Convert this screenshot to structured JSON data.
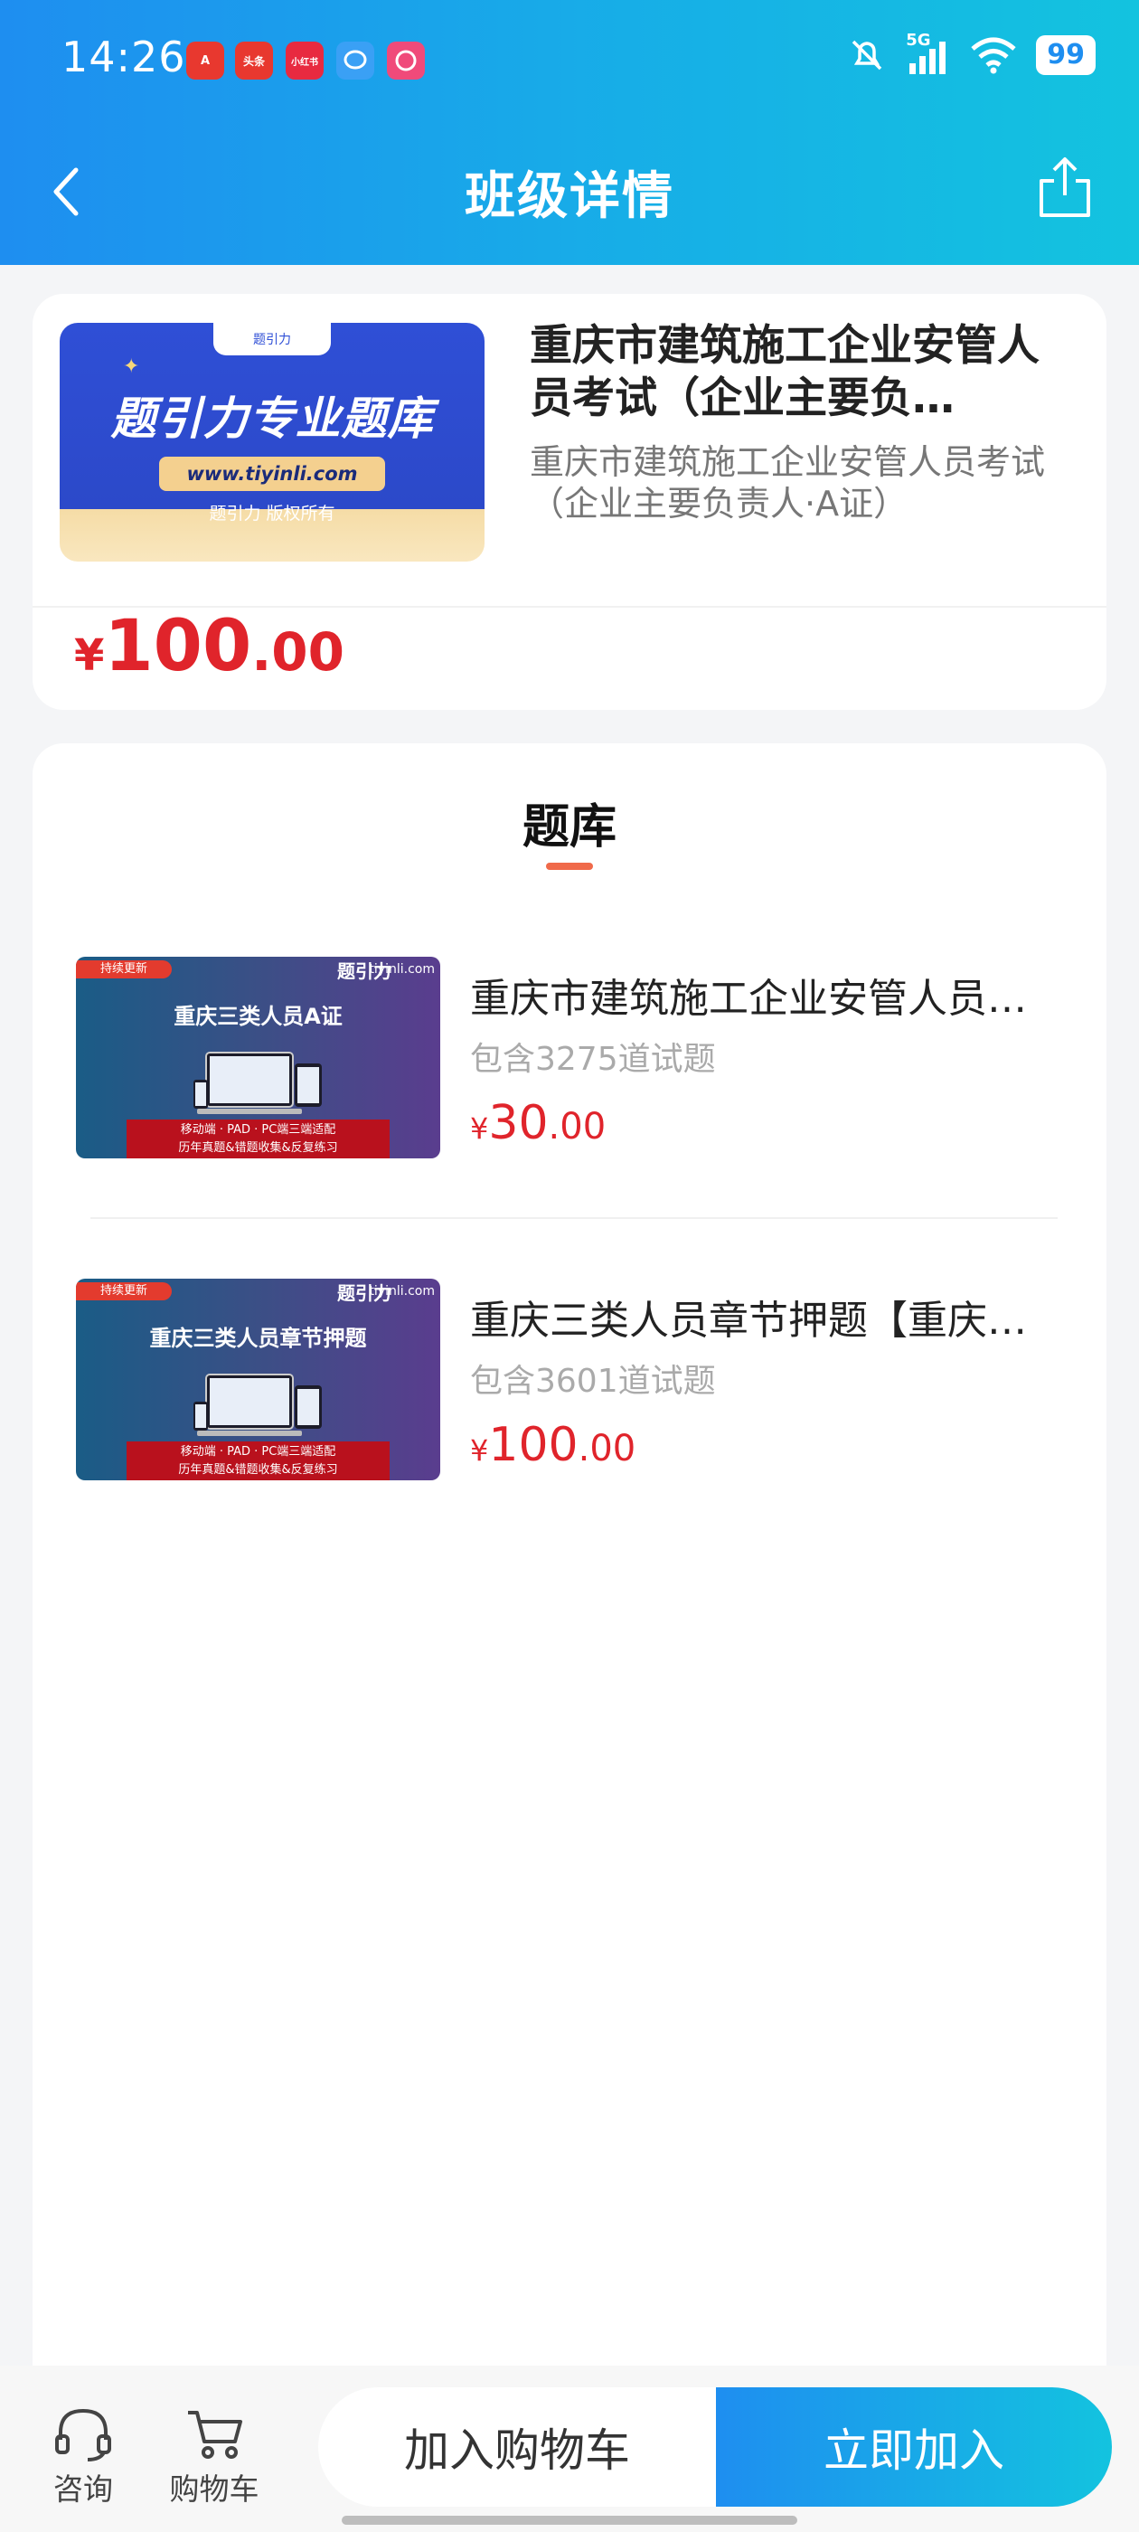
{
  "status_bar": {
    "time": "14:26",
    "network": "5G",
    "battery": "99",
    "apps": [
      {
        "icon": "a-app-icon",
        "label": "A",
        "color": "#e8382f"
      },
      {
        "icon": "toutiao-icon",
        "label": "头条",
        "color": "#e8382f"
      },
      {
        "icon": "xiaohongshu-icon",
        "label": "小红书",
        "color": "#e82a40"
      },
      {
        "icon": "chat-bubble-icon",
        "label": "",
        "color": "#3aa0f5"
      },
      {
        "icon": "messenger-icon",
        "label": "",
        "color": "#f04a7a"
      }
    ]
  },
  "header": {
    "title": "班级详情",
    "back_icon": "chevron-left-icon",
    "share_icon": "share-icon"
  },
  "course": {
    "title": "重庆市建筑施工企业安管人员考试（企业主要负…",
    "subtitle": "重庆市建筑施工企业安管人员考试（企业主要负责人·A证）",
    "price_currency": "¥",
    "price_int": "100",
    "price_dec": ".00",
    "banner": {
      "tab": "题引力",
      "main": "题引力专业题库",
      "url": "www.tiyinli.com",
      "copyright": "题引力 版权所有"
    }
  },
  "tab": {
    "title": "题库"
  },
  "items": [
    {
      "title": "重庆市建筑施工企业安管人员考试（企业主要负责人·A证）",
      "count": "包含3275道试题",
      "price_currency": "¥",
      "price_int": "30",
      "price_dec": ".00",
      "thumb": {
        "tag": "持续更新",
        "logo": "题引力",
        "url": "tiyinli.com",
        "title": "重庆三类人员A证",
        "foot1": "移动端 · PAD · PC端三端适配",
        "foot2": "历年真题&错题收集&反复练习"
      }
    },
    {
      "title": "重庆三类人员章节押题【重庆三类人员A证】",
      "count": "包含3601道试题",
      "price_currency": "¥",
      "price_int": "100",
      "price_dec": ".00",
      "thumb": {
        "tag": "持续更新",
        "logo": "题引力",
        "url": "tiyinli.com",
        "title": "重庆三类人员章节押题",
        "foot1": "移动端 · PAD · PC端三端适配",
        "foot2": "历年真题&错题收集&反复练习"
      }
    }
  ],
  "bottom_bar": {
    "consult_label": "咨询",
    "consult_icon": "headset-icon",
    "cart_label": "购物车",
    "cart_icon": "cart-icon",
    "add_cart_button": "加入购物车",
    "join_button": "立即加入"
  }
}
